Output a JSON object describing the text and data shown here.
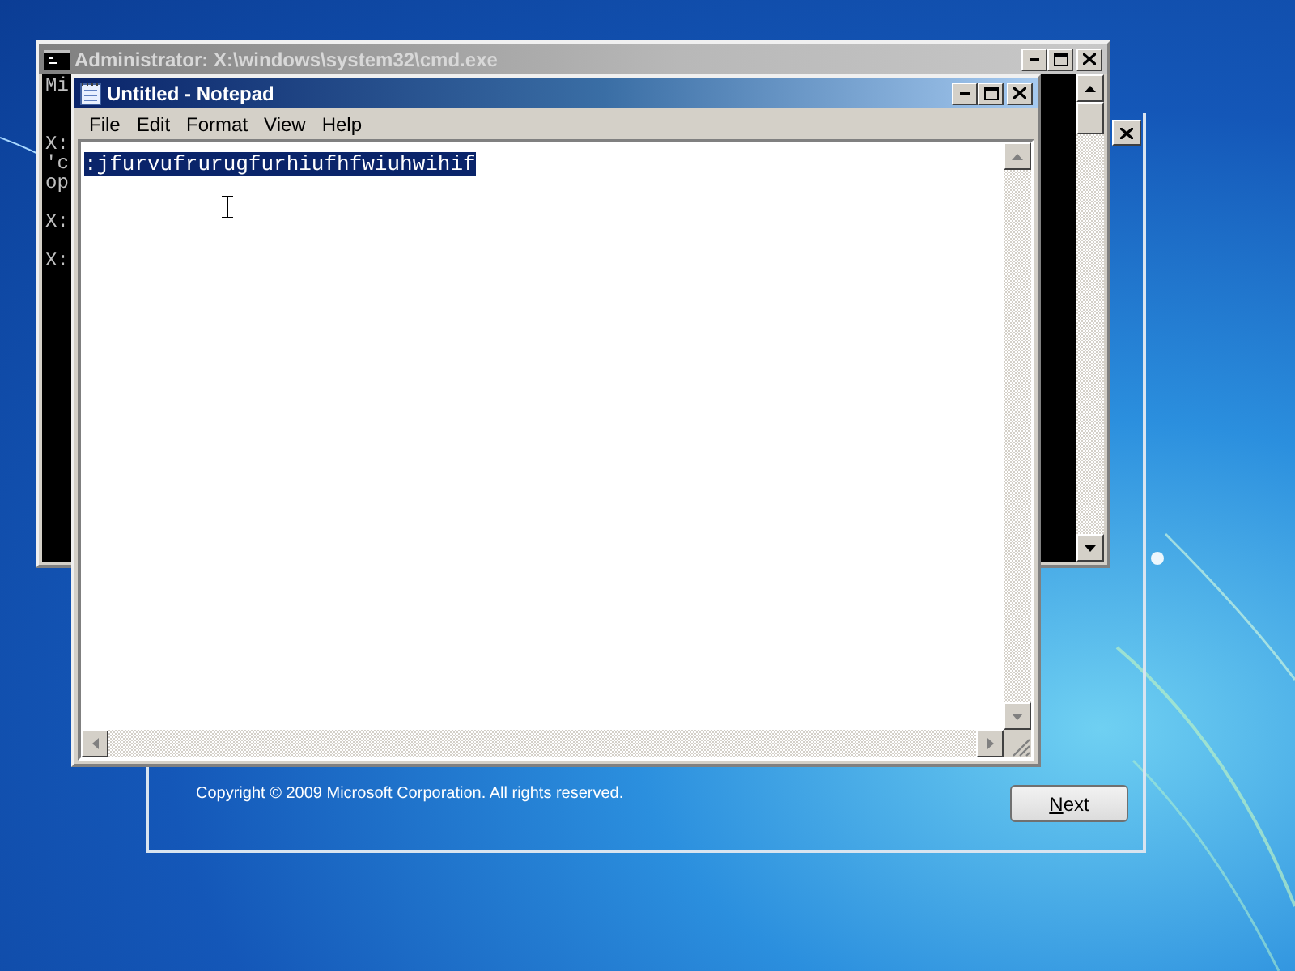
{
  "setup_window": {
    "copyright": "Copyright © 2009 Microsoft Corporation. All rights reserved.",
    "next_button": "Next"
  },
  "cmd_window": {
    "title": "Administrator: X:\\windows\\system32\\cmd.exe",
    "active": false,
    "console_lines": [
      {
        "kind": "text",
        "text": "Mi"
      },
      {
        "kind": "blank"
      },
      {
        "kind": "blank"
      },
      {
        "kind": "text",
        "text": "X:"
      },
      {
        "kind": "text",
        "text": "'c"
      },
      {
        "kind": "text",
        "text": "op"
      },
      {
        "kind": "blank"
      },
      {
        "kind": "text",
        "text": "X:"
      },
      {
        "kind": "blank"
      },
      {
        "kind": "text",
        "text": "X:"
      }
    ]
  },
  "notepad_window": {
    "title": "Untitled - Notepad",
    "active": true,
    "menu": [
      "File",
      "Edit",
      "Format",
      "View",
      "Help"
    ],
    "content": {
      "text": ":jfurvufrurugfurhiufhfwiuhwihif",
      "selected": true
    }
  }
}
